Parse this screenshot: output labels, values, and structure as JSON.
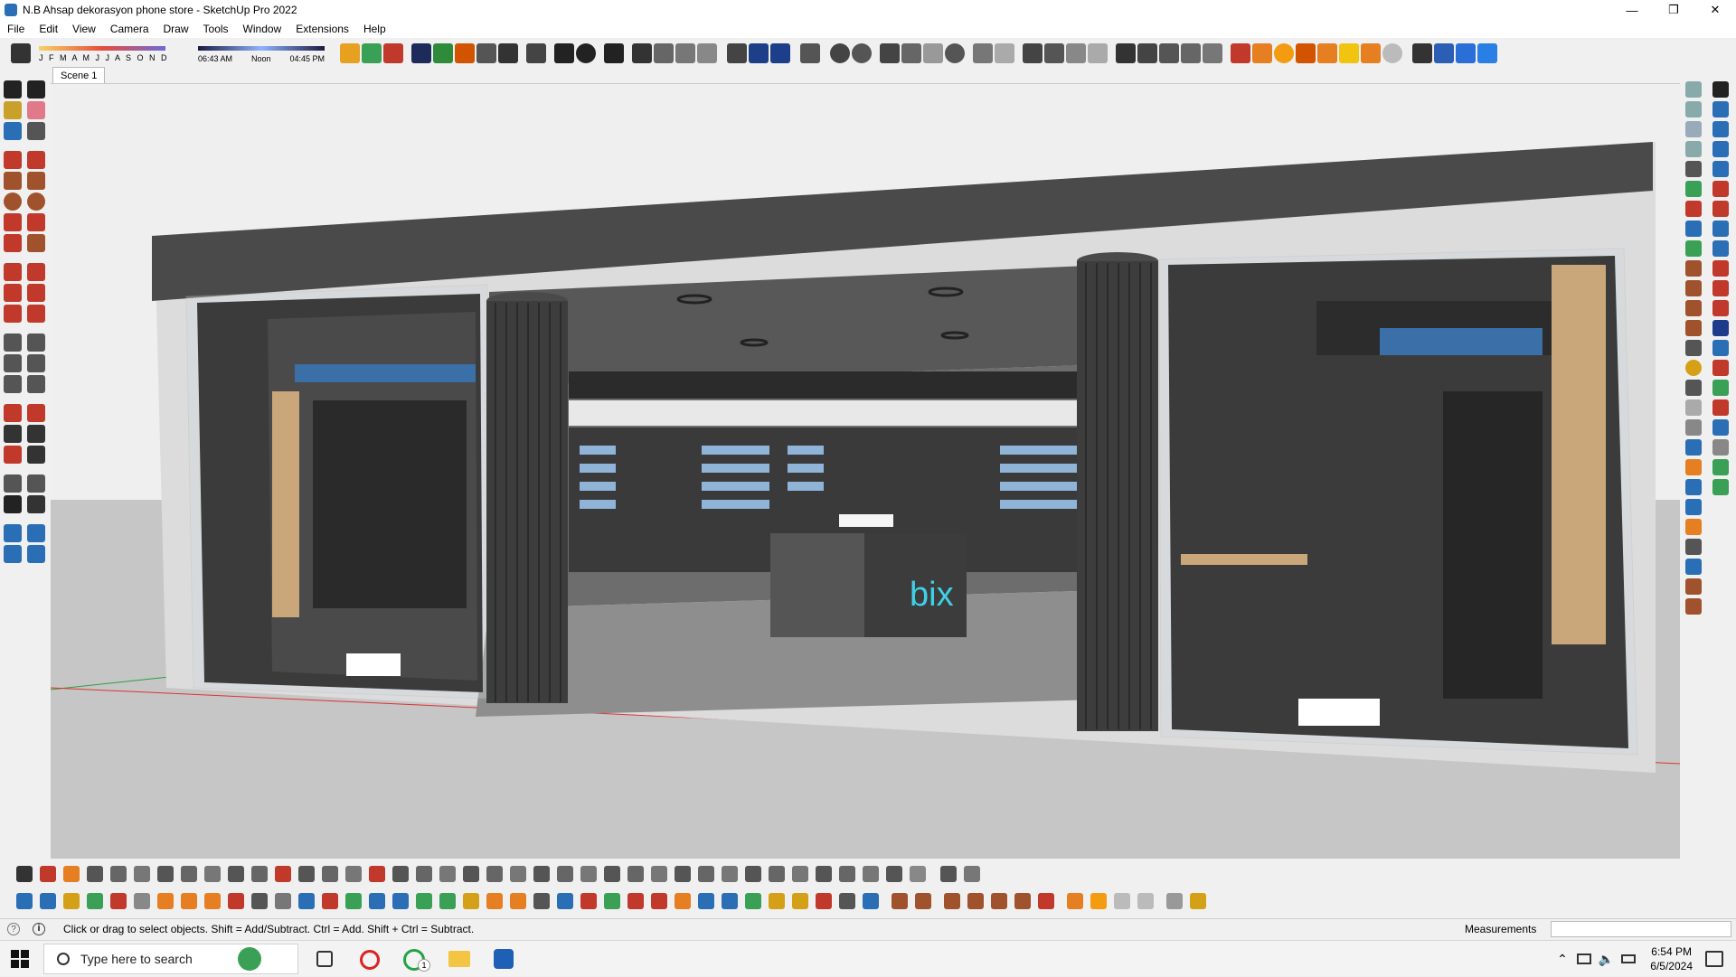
{
  "window": {
    "title": "N.B Ahsap dekorasyon phone store - SketchUp Pro 2022",
    "minimize": "—",
    "maximize": "❐",
    "close": "✕"
  },
  "menu": [
    "File",
    "Edit",
    "View",
    "Camera",
    "Draw",
    "Tools",
    "Window",
    "Extensions",
    "Help"
  ],
  "shadow": {
    "months": "J F M A M J J A S O N D",
    "time_start": "06:43 AM",
    "time_mid": "Noon",
    "time_end": "04:45 PM"
  },
  "scene_tab": "Scene 1",
  "model": {
    "brand_sign": "bix",
    "colors": {
      "ceiling": "#4a4a4a",
      "floor": "#a4a4a4",
      "wood": "#c9a77a",
      "dark": "#2b2b2b",
      "accent": "#3fd0e8"
    }
  },
  "status": {
    "hint": "Click or drag to select objects. Shift = Add/Subtract. Ctrl = Add. Shift + Ctrl = Subtract.",
    "measurements_label": "Measurements",
    "measurements_value": ""
  },
  "taskbar": {
    "search_placeholder": "Type here to search",
    "whatsapp_badge": "1",
    "time": "6:54 PM",
    "date": "6/5/2024"
  }
}
